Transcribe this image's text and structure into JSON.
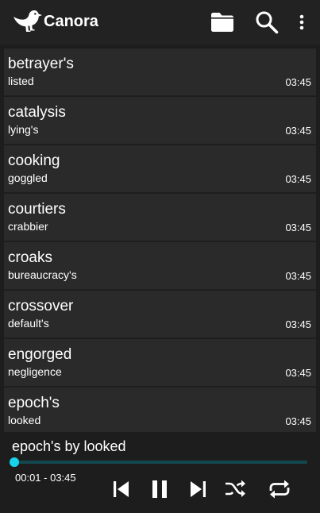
{
  "app": {
    "title": "Canora",
    "actions": [
      {
        "name": "folder-icon"
      },
      {
        "name": "search-icon"
      },
      {
        "name": "more-vert-icon"
      }
    ]
  },
  "songs": [
    {
      "title": "betrayer's",
      "artist": "listed",
      "duration": "03:45"
    },
    {
      "title": "catalysis",
      "artist": "lying's",
      "duration": "03:45"
    },
    {
      "title": "cooking",
      "artist": "goggled",
      "duration": "03:45"
    },
    {
      "title": "courtiers",
      "artist": "crabbier",
      "duration": "03:45"
    },
    {
      "title": "croaks",
      "artist": "bureaucracy's",
      "duration": "03:45"
    },
    {
      "title": "crossover",
      "artist": "default's",
      "duration": "03:45"
    },
    {
      "title": "engorged",
      "artist": "negligence",
      "duration": "03:45"
    },
    {
      "title": "epoch's",
      "artist": "looked",
      "duration": "03:45"
    }
  ],
  "player": {
    "now_playing": "epoch's by looked",
    "time_text": "00:01 - 03:45",
    "progress_fraction": 0.004,
    "controls": [
      "skip-previous-icon",
      "pause-icon",
      "skip-next-icon",
      "shuffle-icon",
      "repeat-icon"
    ]
  },
  "colors": {
    "accent": "#18d4ea",
    "track": "#13484f",
    "background": "#1d1d1d",
    "row": "#2a2a2a",
    "toolbar": "#222222"
  }
}
